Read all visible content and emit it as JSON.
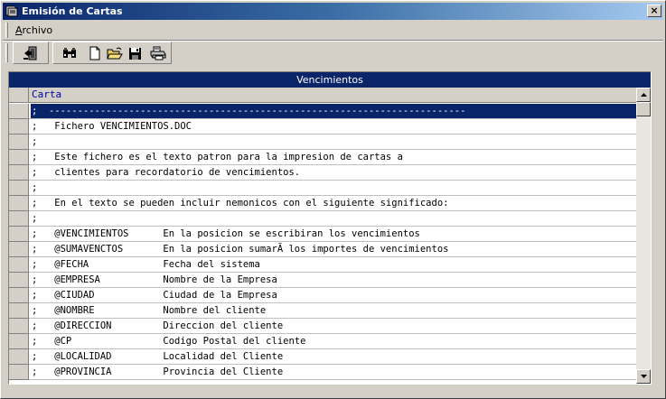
{
  "window": {
    "title": "Emisión de Cartas",
    "close_label": "×"
  },
  "menu": {
    "items": [
      {
        "label_first": "A",
        "label_rest": "rchivo"
      }
    ]
  },
  "toolbar": {
    "buttons": [
      {
        "icon": "exit-door-icon"
      },
      {
        "icon": "binoculars-icon"
      },
      {
        "icon": "new-document-icon"
      },
      {
        "icon": "open-folder-icon"
      },
      {
        "icon": "save-disk-icon"
      },
      {
        "icon": "print-preview-icon"
      }
    ]
  },
  "grid": {
    "caption": "Vencimientos",
    "column_header": "Carta",
    "rows": [
      ";  -------------------------------------------------------------------------",
      ";   Fichero VENCIMIENTOS.DOC",
      ";",
      ";   Este fichero es el texto patron para la impresion de cartas a",
      ";   clientes para recordatorio de vencimientos.",
      ";",
      ";   En el texto se pueden incluir nemonicos con el siguiente significado:",
      ";",
      ";   @VENCIMIENTOS      En la posicion se escribiran los vencimientos",
      ";   @SUMAVENCTOS       En la posicion sumarÃ los importes de vencimientos",
      ";   @FECHA             Fecha del sistema",
      ";   @EMPRESA           Nombre de la Empresa",
      ";   @CIUDAD            Ciudad de la Empresa",
      ";   @NOMBRE            Nombre del cliente",
      ";   @DIRECCION         Direccion del cliente",
      ";   @CP                Codigo Postal del cliente",
      ";   @LOCALIDAD         Localidad del Cliente",
      ";   @PROVINCIA         Provincia del Cliente"
    ],
    "selected_row": 1
  }
}
